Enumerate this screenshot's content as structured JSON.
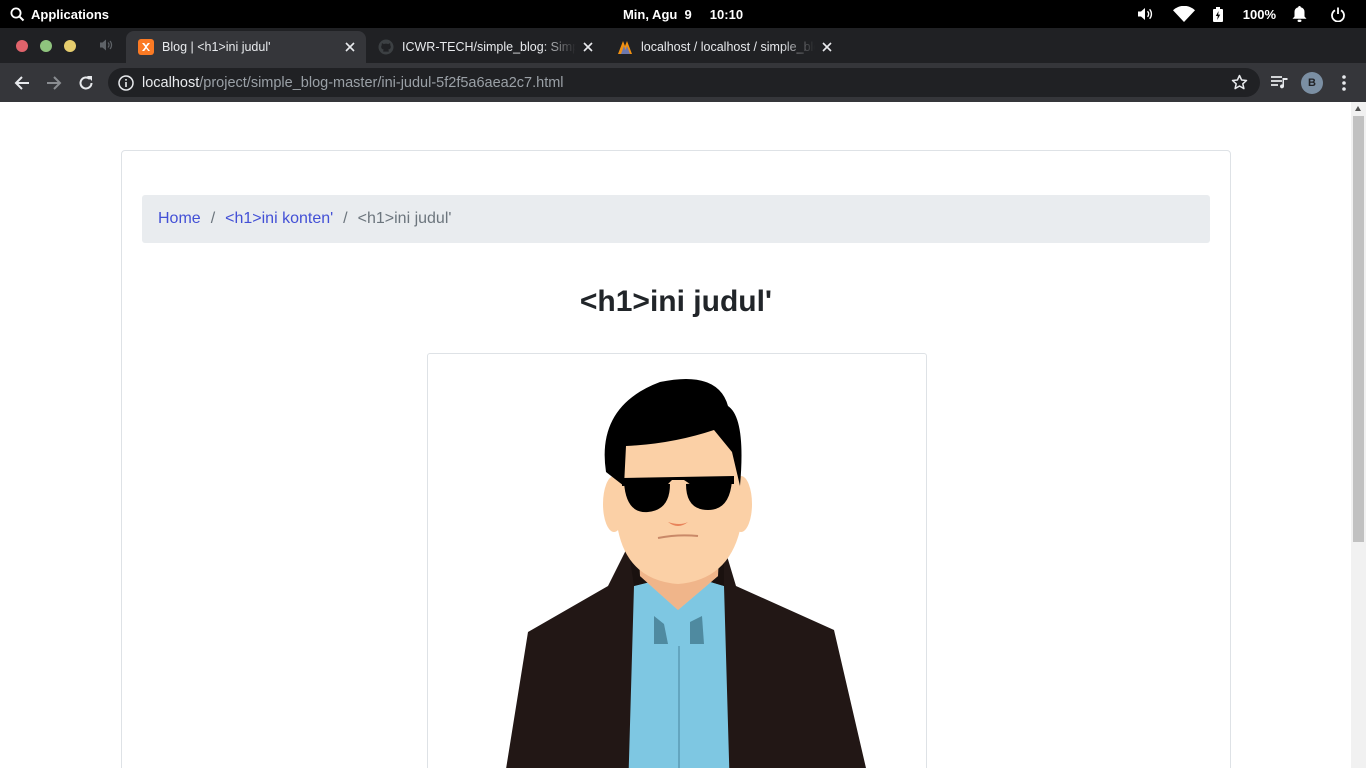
{
  "topbar": {
    "applications_label": "Applications",
    "date": "Min, Agu  9",
    "time": "10:10",
    "battery": "100%"
  },
  "tabs": [
    {
      "title": "Blog | <h1>ini judul'",
      "favicon": "xampp-icon",
      "active": true
    },
    {
      "title": "ICWR-TECH/simple_blog: Simple",
      "favicon": "github-icon",
      "active": false
    },
    {
      "title": "localhost / localhost / simple_blog",
      "favicon": "phpmyadmin-icon",
      "active": false
    }
  ],
  "toolbar": {
    "url_host": "localhost",
    "url_path": "/project/simple_blog-master/ini-judul-5f2f5a6aea2c7.html",
    "profile_initial": "B"
  },
  "page": {
    "breadcrumb": {
      "home": "Home",
      "category": "<h1>ini konten'",
      "current": "<h1>ini judul'",
      "separator": "/"
    },
    "title": "<h1>ini judul'",
    "image_description": "illustration-man-with-sunglasses"
  },
  "colors": {
    "link": "#4350d6",
    "breadcrumb_bg": "#e9ecef",
    "tab_active": "#35363a",
    "tab_strip": "#202124"
  }
}
